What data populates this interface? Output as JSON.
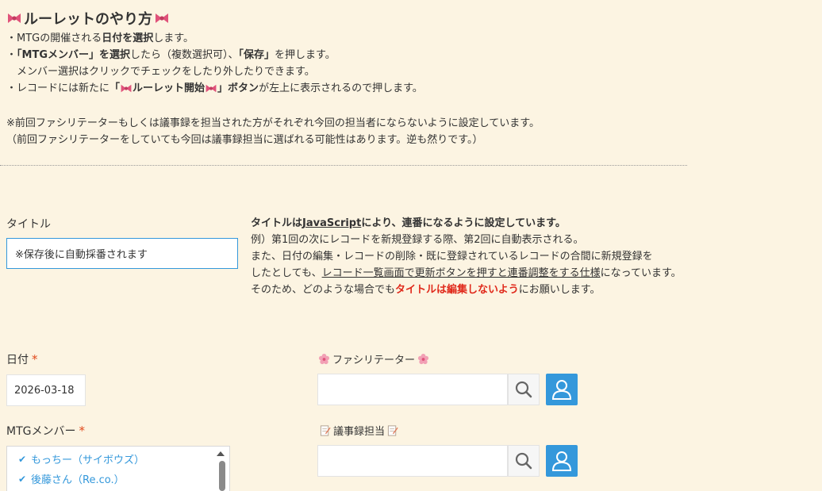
{
  "guide": {
    "title": "ルーレットのやり方",
    "line1_a": "・MTGの開催される",
    "line1_b": "日付を選択",
    "line1_c": "します。",
    "line2_a": "・",
    "line2_b": "「MTGメンバー」を選択",
    "line2_c": "したら（複数選択可）、",
    "line2_d": "「保存」",
    "line2_e": "を押します。",
    "line3": "　メンバー選択はクリックでチェックをしたり外したりできます。",
    "line4_a": "・レコードには新たに",
    "line4_b": "「",
    "line4_c": "ルーレット開始",
    "line4_d": "」ボタン",
    "line4_e": "が左上に表示されるので押します。",
    "note1": "※前回ファシリテーターもしくは議事録を担当された方がそれぞれ今回の担当者にならないように設定しています。",
    "note2": "（前回ファシリテーターをしていても今回は議事録担当に選ばれる可能性はあります。逆も然りです。）"
  },
  "title_field": {
    "label": "タイトル",
    "value": "※保存後に自動採番されます"
  },
  "title_desc": {
    "l1_a": "タイトルは",
    "l1_b": "JavaScript",
    "l1_c": "により、連番になるように設定しています。",
    "l2": "例）第1回の次にレコードを新規登録する際、第2回に自動表示される。",
    "l3": "また、日付の編集・レコードの削除・既に登録されているレコードの合間に新規登録を",
    "l4_a": "したとしても、",
    "l4_b": "レコード一覧画面で更新ボタンを押すと連番調整をする仕様",
    "l4_c": "になっています。",
    "l5_a": "そのため、どのような場合でも",
    "l5_b": "タイトルは編集しないよう",
    "l5_c": "にお願いします。"
  },
  "date_field": {
    "label": "日付",
    "required": "*",
    "value": "2026-03-18"
  },
  "members_field": {
    "label": "MTGメンバー",
    "required": "*",
    "items": [
      "もっちー（サイボウズ）",
      "後藤さん（Re.co.）"
    ]
  },
  "facilitator_field": {
    "label": "ファシリテーター"
  },
  "minutes_field": {
    "label": "議事録担当"
  },
  "colors": {
    "background": "#fcf4e2",
    "accent": "#3498db",
    "required": "#e0491b",
    "warning": "#e0291b"
  }
}
